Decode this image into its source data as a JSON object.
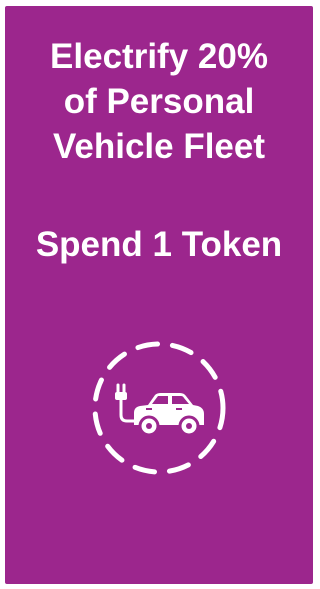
{
  "card": {
    "title_lines": [
      "Electrify 20%",
      "of Personal",
      "Vehicle Fleet"
    ],
    "cost": "Spend 1 Token",
    "icon": "electric-car-charging-icon",
    "background_color": "#9c268d",
    "text_color": "#ffffff"
  }
}
